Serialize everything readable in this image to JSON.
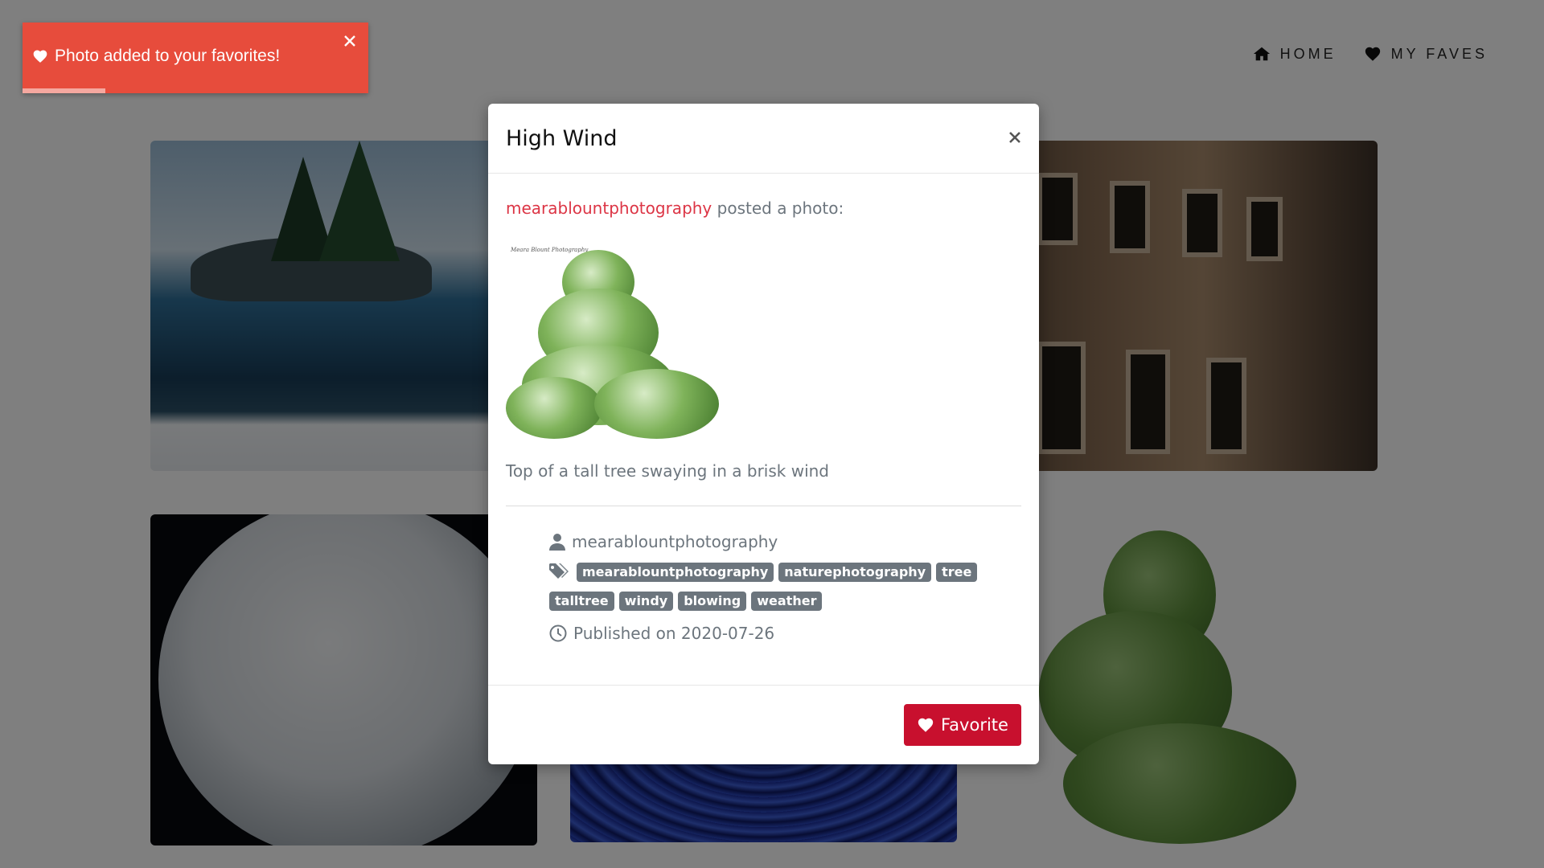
{
  "nav": {
    "home_label": "HOME",
    "home_icon": "home-icon",
    "faves_label": "MY FAVES",
    "faves_icon": "heart-icon"
  },
  "toast": {
    "message": "Photo added to your favorites!",
    "icon": "heart-icon",
    "close_icon": "close-icon",
    "progress": 0.24,
    "color": "#e74c3c"
  },
  "modal": {
    "title": "High Wind",
    "close_icon": "close-icon",
    "author": "mearablountphotography",
    "posted_text": "posted a photo:",
    "photo_watermark": "Meara Blount Photography",
    "description": "Top of a tall tree swaying in a brisk wind",
    "username": "mearablountphotography",
    "user_icon": "user-icon",
    "tags_icon": "tags-icon",
    "tags": [
      "mearablountphotography",
      "naturephotography",
      "tree",
      "talltree",
      "windy",
      "blowing",
      "weather"
    ],
    "clock_icon": "clock-icon",
    "published": "Published on 2020-07-26",
    "favorite_label": "Favorite",
    "favorite_icon": "heart-icon",
    "favorite_color": "#c8102e"
  },
  "colors": {
    "author_link": "#dc3545",
    "muted_text": "#6c757d",
    "backdrop": "rgba(0,0,0,0.5)"
  }
}
